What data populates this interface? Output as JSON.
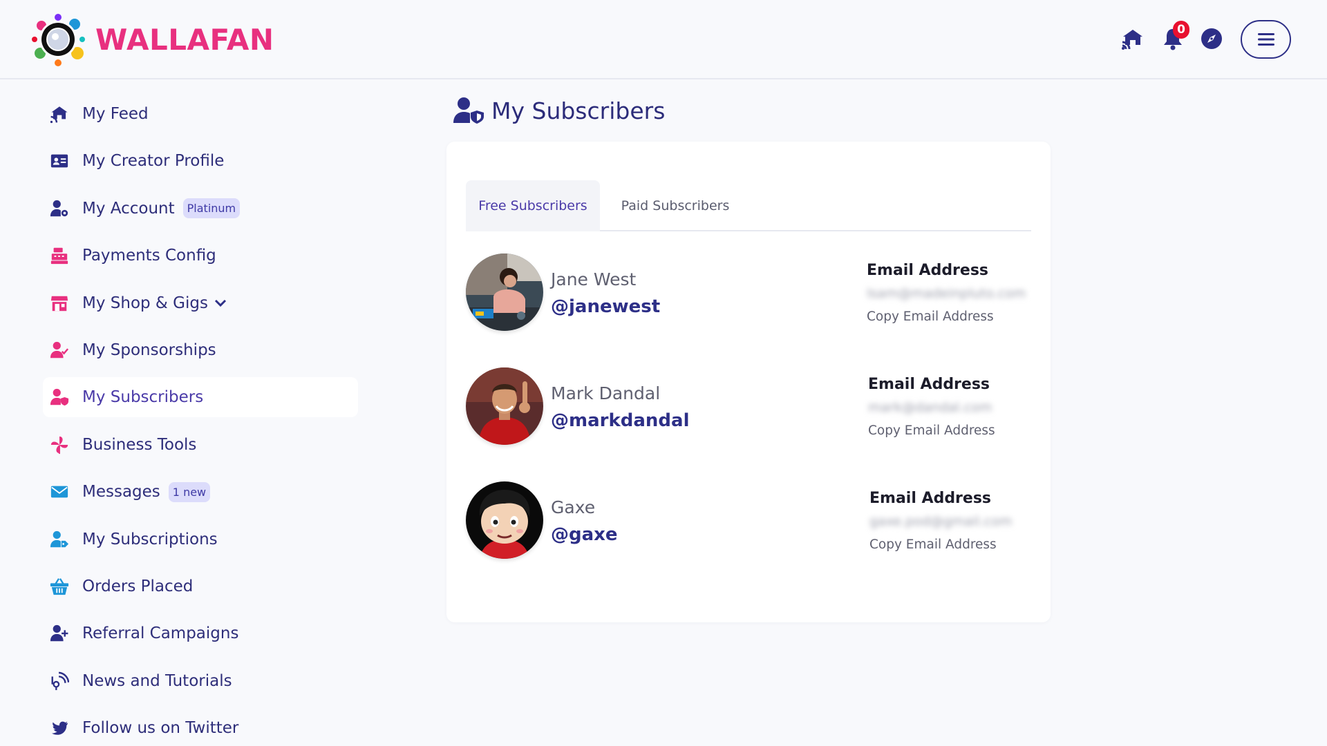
{
  "header": {
    "brand_name": "WALLAFAN",
    "brand_color": "#e8307f",
    "notification_count": "0",
    "notification_badge_color": "#e8102f",
    "icons": [
      "feed-icon",
      "bell-icon",
      "compass-icon",
      "hamburger-menu-icon"
    ]
  },
  "sidebar": {
    "items": [
      {
        "label": "My Feed",
        "icon": "feed-icon",
        "icon_color": "#2d2f87"
      },
      {
        "label": "My Creator Profile",
        "icon": "id-card-icon",
        "icon_color": "#2d2f87"
      },
      {
        "label": "My Account",
        "icon": "user-gear-icon",
        "icon_color": "#2d2f87",
        "tag": "Platinum"
      },
      {
        "label": "Payments Config",
        "icon": "cash-register-icon",
        "icon_color": "#e8307f"
      },
      {
        "label": "My Shop & Gigs",
        "icon": "shop-icon",
        "icon_color": "#e8307f"
      },
      {
        "label": "My Sponsorships",
        "icon": "user-check-icon",
        "icon_color": "#e8307f"
      },
      {
        "label": "My Subscribers",
        "icon": "user-shield-icon",
        "icon_color": "#e8307f"
      },
      {
        "label": "Business Tools",
        "icon": "pinwheel-icon",
        "icon_color": "#e8307f"
      },
      {
        "label": "Messages",
        "icon": "envelope-icon",
        "icon_color": "#1e96d8",
        "tag": "1 new"
      },
      {
        "label": "My Subscriptions",
        "icon": "user-tag-icon",
        "icon_color": "#1e96d8"
      },
      {
        "label": "Orders Placed",
        "icon": "basket-icon",
        "icon_color": "#1e96d8"
      },
      {
        "label": "Referral Campaigns",
        "icon": "user-plus-icon",
        "icon_color": "#2d2f87"
      },
      {
        "label": "News and Tutorials",
        "icon": "broadcast-icon",
        "icon_color": "#2d2f87"
      },
      {
        "label": "Follow us on Twitter",
        "icon": "twitter-icon",
        "icon_color": "#2d2f87"
      }
    ],
    "active": "My Subscribers"
  },
  "main": {
    "title": "My Subscribers",
    "tabs": [
      {
        "label": "Free Subscribers",
        "active": true
      },
      {
        "label": "Paid Subscribers",
        "active": false
      }
    ],
    "subscribers": [
      {
        "name": "Jane West",
        "handle": "@janewest",
        "email_label": "Email Address",
        "email": "lsam@madeinpluto.com",
        "copy_label": "Copy Email Address"
      },
      {
        "name": "Mark Dandal",
        "handle": "@markdandal",
        "email_label": "Email Address",
        "email": "mark@dandal.com",
        "copy_label": "Copy Email Address"
      },
      {
        "name": "Gaxe",
        "handle": "@gaxe",
        "email_label": "Email Address",
        "email": "gaxe.pod@gmail.com",
        "copy_label": "Copy Email Address"
      }
    ]
  }
}
